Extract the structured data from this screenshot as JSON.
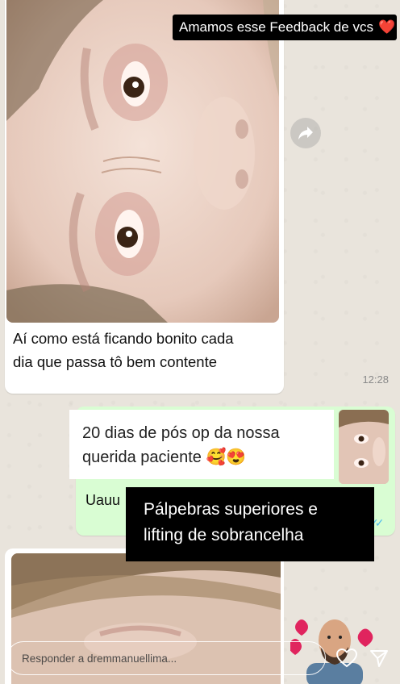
{
  "story": {
    "header_tag": "Amamos esse Feedback de vcs",
    "header_emoji": "❤️",
    "overlay_white": {
      "line1": "20 dias de pós op da nossa",
      "line2": "querida paciente 🥰😍"
    },
    "overlay_black": {
      "line1": "Pálpebras superiores e",
      "line2": "lifting de sobrancelha"
    }
  },
  "chat": {
    "incoming_caption_line1": "Aí como está ficando bonito cada",
    "incoming_caption_line2": "dia que passa tô bem contente",
    "incoming_time": "12:28",
    "outgoing_partial_text": "Uauu"
  },
  "reply": {
    "placeholder": "Responder a dremmanuellima..."
  },
  "icons": [
    "forward-icon",
    "heart-icon",
    "send-icon"
  ],
  "colors": {
    "outgoing_bubble": "#d9fdd3",
    "incoming_bubble": "#ffffff",
    "read_ticks": "#53bdeb",
    "heart_red": "#e0245e"
  }
}
